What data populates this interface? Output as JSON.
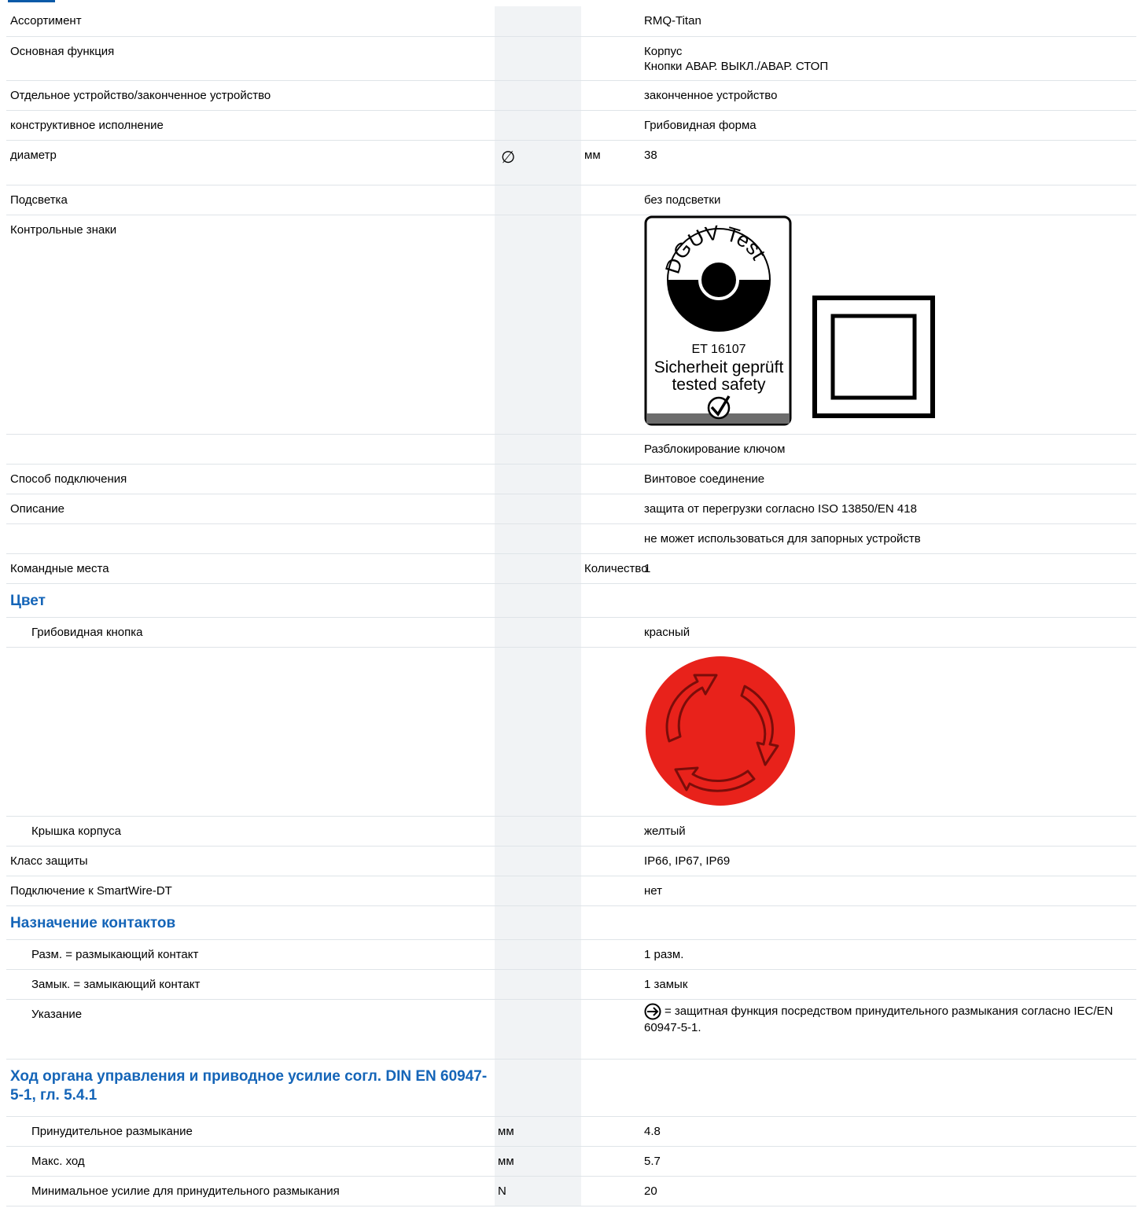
{
  "general": [
    {
      "label": "Ассортимент",
      "value": "RMQ-Titan"
    },
    {
      "label": "Основная функция",
      "values": [
        "Корпус",
        "Кнопки АВАР. ВЫКЛ./АВАР. СТОП"
      ]
    },
    {
      "label": "Отдельное устройство/законченное устройство",
      "value": "законченное устройство"
    },
    {
      "label": "конструктивное исполнение",
      "value": "Грибовидная форма"
    },
    {
      "label": "диаметр",
      "symbol": "∅",
      "unit": "мм",
      "value": "38"
    },
    {
      "label": "Подсветка",
      "value": "без подсветки"
    },
    {
      "label": "Контрольные знаки"
    },
    {
      "label": "",
      "value": "Разблокирование ключом"
    },
    {
      "label": "Способ подключения",
      "value": "Винтовое соединение"
    },
    {
      "label": "Описание",
      "value": "защита от перегрузки согласно ISO 13850/EN 418"
    },
    {
      "label": "",
      "value": "не может использоваться для запорных устройств"
    },
    {
      "label": "Командные места",
      "unit": "Количество",
      "value": "1"
    }
  ],
  "cert": {
    "dguv_text": "DGUV Test",
    "et_number": "ET 16107",
    "line1": "Sicherheit geprüft",
    "line2": "tested safety"
  },
  "color_section": {
    "title": "Цвет",
    "mushroom_label": "Грибовидная кнопка",
    "mushroom_value": "красный",
    "button_color": "#e8221b",
    "cover_label": "Крышка корпуса",
    "cover_value": "желтый"
  },
  "more": [
    {
      "label": "Класс защиты",
      "value": "IP66, IP67, IP69"
    },
    {
      "label": "Подключение к SmartWire-DT",
      "value": "нет"
    }
  ],
  "contacts_section": {
    "title": "Назначение контактов",
    "rows": [
      {
        "label": "Разм. = размыкающий контакт",
        "value": "1 разм."
      },
      {
        "label": "Замык. = замыкающий контакт",
        "value": "1 замык"
      }
    ],
    "note_label": "Указание",
    "note_value": "= защитная функция посредством принудительного размыкания согласно IEC/EN 60947-5-1."
  },
  "travel_section": {
    "title": "Ход органа управления и приводное усилие согл. DIN EN 60947-5-1, гл. 5.4.1",
    "rows": [
      {
        "label": "Принудительное размыкание",
        "unit": "мм",
        "value": "4.8"
      },
      {
        "label": "Макс. ход",
        "unit": "мм",
        "value": "5.7"
      },
      {
        "label": "Минимальное усилие для принудительного размыкания",
        "unit": "N",
        "value": "20"
      }
    ]
  }
}
